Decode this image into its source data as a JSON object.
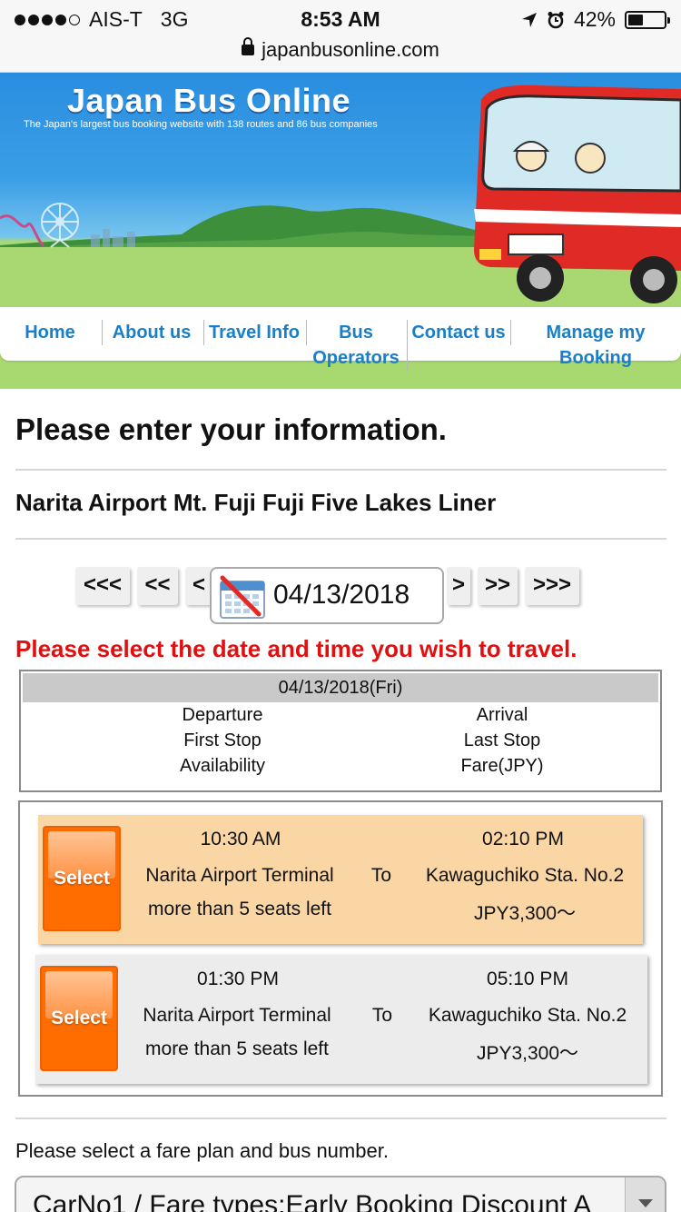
{
  "status": {
    "carrier": "AIS-T",
    "network": "3G",
    "time": "8:53 AM",
    "battery": "42%",
    "battery_level": 0.42
  },
  "browser": {
    "url": "japanbusonline.com"
  },
  "banner": {
    "logo": "Japan Bus Online",
    "tagline": "The Japan's largest bus booking website with 138 routes and 86 bus companies"
  },
  "nav": {
    "home": "Home",
    "about": "About us",
    "travel": "Travel Info",
    "bus_1": "Bus",
    "bus_2": "Operators",
    "contact": "Contact us",
    "manage_1": "Manage my",
    "manage_2": "Booking"
  },
  "page": {
    "title": "Please enter your information.",
    "route": "Narita Airport Mt. Fuji Fuji Five Lakes Liner",
    "warning": "Please select the date and time you wish to travel."
  },
  "date_nav": {
    "prev3": "<<<",
    "prev2": "<<",
    "prev1": "<",
    "date": "04/13/2018",
    "next1": ">",
    "next2": ">>",
    "next3": ">>>"
  },
  "table_header": {
    "date": "04/13/2018(Fri)",
    "departure": "Departure",
    "arrival": "Arrival",
    "first_stop": "First Stop",
    "last_stop": "Last Stop",
    "availability": "Availability",
    "fare": "Fare(JPY)"
  },
  "trips": [
    {
      "select": "Select",
      "dep": "10:30 AM",
      "arr": "02:10 PM",
      "from": "Narita Airport Terminal",
      "to_word": "To",
      "to": "Kawaguchiko Sta. No.2",
      "seats": "more than 5 seats left",
      "fare": "JPY3,300～",
      "highlight": "#fad6a5"
    },
    {
      "select": "Select",
      "dep": "01:30 PM",
      "arr": "05:10 PM",
      "from": "Narita Airport Terminal",
      "to_word": "To",
      "to": "Kawaguchiko Sta. No.2",
      "seats": "more than 5 seats left",
      "fare": "JPY3,300～",
      "highlight": "#ececec"
    }
  ],
  "fare": {
    "label": "Please select a fare plan and bus number.",
    "selected": "CarNo1 / Fare types:Early Booking Discount A"
  },
  "colors": {
    "brand_blue": "#1a7fc9",
    "warning_red": "#e01010",
    "select_orange": "#ff6d00"
  }
}
